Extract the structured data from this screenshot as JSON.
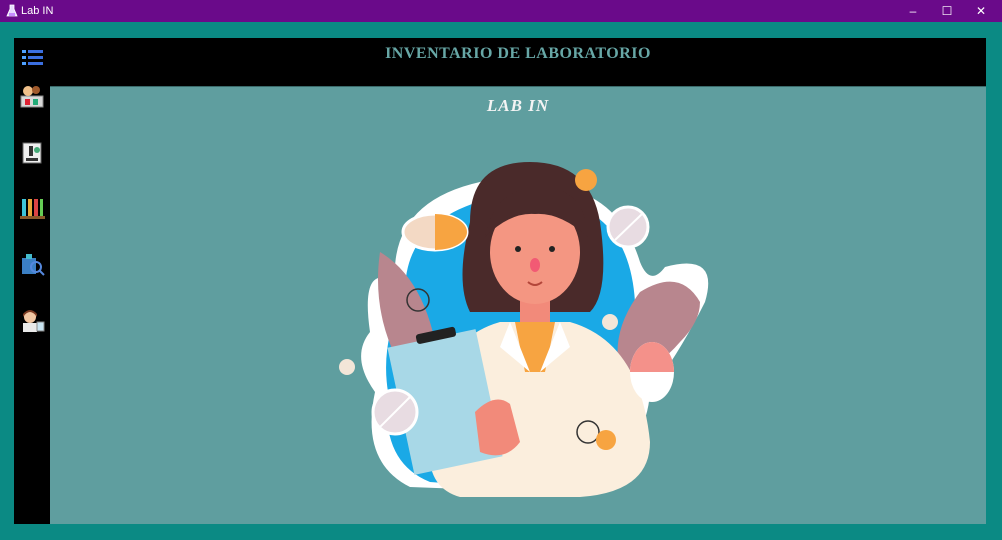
{
  "window": {
    "title": "Lab IN",
    "controls": {
      "minimize": "–",
      "maximize": "☐",
      "close": "✕"
    }
  },
  "header": {
    "title": "INVENTARIO DE LABORATORIO"
  },
  "content": {
    "subtitle": "LAB IN"
  },
  "sidebar": {
    "items": [
      {
        "icon": "menu-list-icon"
      },
      {
        "icon": "lab-equipment-icon"
      },
      {
        "icon": "microscope-icon"
      },
      {
        "icon": "test-tubes-icon"
      },
      {
        "icon": "lab-search-icon"
      },
      {
        "icon": "scientist-icon"
      }
    ]
  },
  "colors": {
    "titlebar": "#6a0a8a",
    "frame": "#0b8a84",
    "panel": "#000000",
    "content": "#5f9e9f",
    "header_text": "#67a7a6"
  }
}
